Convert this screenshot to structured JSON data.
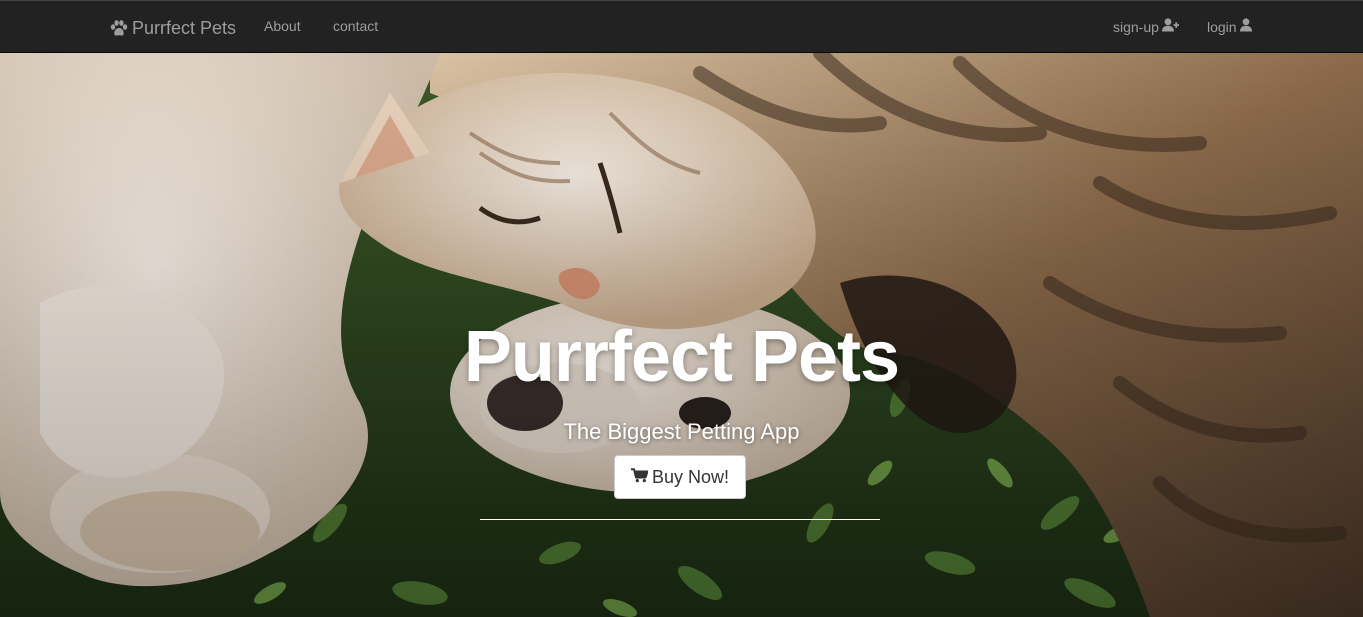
{
  "navbar": {
    "brand": {
      "label": "Purrfect Pets",
      "icon": "paw-icon"
    },
    "links": {
      "about": "About",
      "contact": "contact",
      "signup": {
        "label": "sign-up",
        "icon": "user-plus-icon"
      },
      "login": {
        "label": "login",
        "icon": "user-icon"
      }
    },
    "colors": {
      "background": "#222222",
      "text": "#9d9d9d"
    }
  },
  "hero": {
    "title": "Purrfect Pets",
    "subtitle": "The Biggest Petting App",
    "button": {
      "label": "Buy Now!",
      "icon": "shopping-cart-icon"
    },
    "image_subject": "cat and dog cuddling on grass"
  }
}
